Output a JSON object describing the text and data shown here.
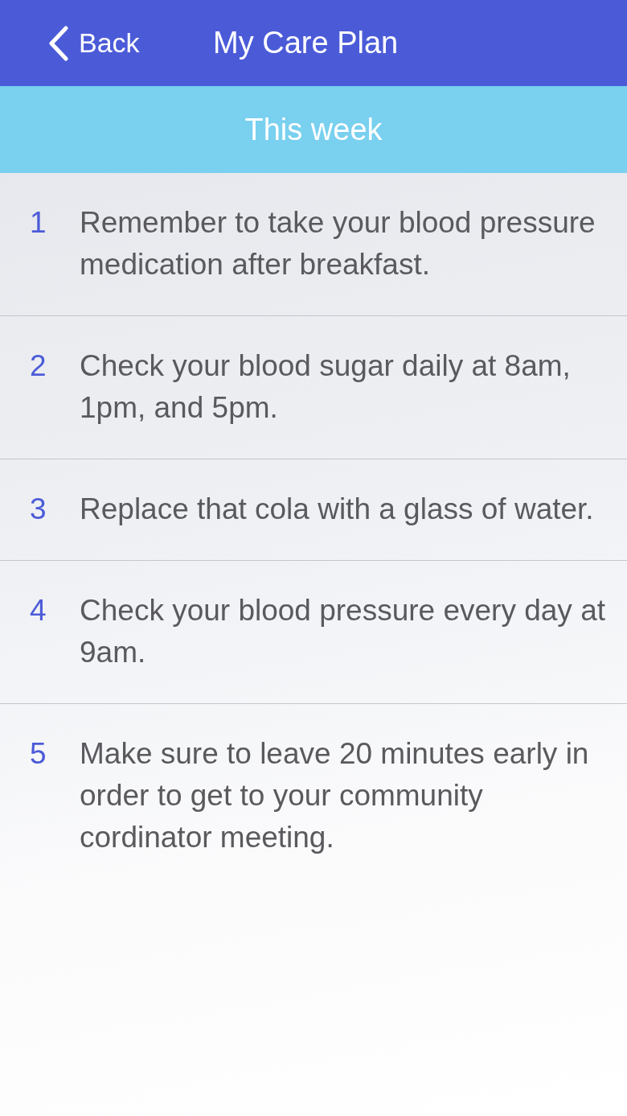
{
  "header": {
    "back_label": "Back",
    "title": "My Care Plan"
  },
  "section": {
    "title": "This week"
  },
  "items": [
    {
      "number": "1",
      "text": "Remember to take your blood pressure medication after breakfast."
    },
    {
      "number": "2",
      "text": "Check your blood sugar daily at 8am, 1pm, and 5pm."
    },
    {
      "number": "3",
      "text": "Replace that cola with a glass of water."
    },
    {
      "number": "4",
      "text": "Check your blood pressure every day at 9am."
    },
    {
      "number": "5",
      "text": "Make sure to leave 20 minutes early in order to get to your community cordinator meeting."
    }
  ]
}
